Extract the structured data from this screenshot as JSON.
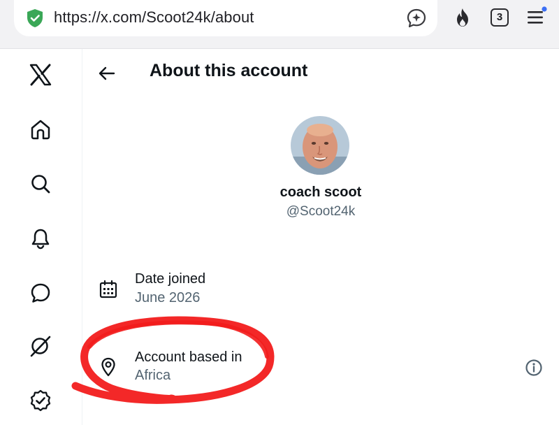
{
  "browser": {
    "url": "https://x.com/Scoot24k/about",
    "tab_count": "3",
    "icons": {
      "security": "shield-check-icon",
      "assistant": "sparkle-chat-icon",
      "trending": "flame-icon",
      "menu": "hamburger-menu-icon"
    },
    "colors": {
      "shield": "#3aa757",
      "notification_dot": "#3b6ff5"
    }
  },
  "nav": {
    "items": [
      {
        "name": "x-logo"
      },
      {
        "name": "home"
      },
      {
        "name": "search"
      },
      {
        "name": "notifications"
      },
      {
        "name": "messages"
      },
      {
        "name": "grok"
      },
      {
        "name": "verified"
      }
    ]
  },
  "header": {
    "title": "About this account"
  },
  "profile": {
    "display_name": "coach scoot",
    "handle": "@Scoot24k"
  },
  "details": {
    "date_joined_label": "Date joined",
    "date_joined_value": "June 2026",
    "location_label": "Account based in",
    "location_value": "Africa"
  },
  "annotation": {
    "color": "#f21c1c"
  }
}
